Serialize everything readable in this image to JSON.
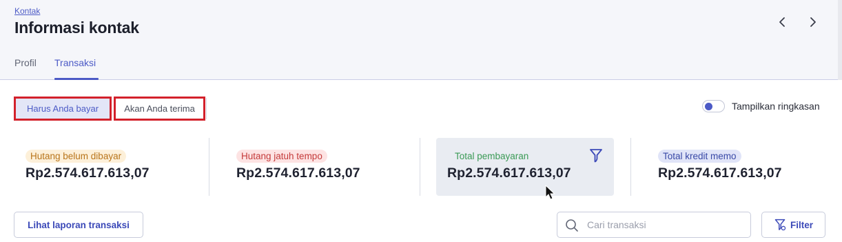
{
  "breadcrumb": "Kontak",
  "title": "Informasi kontak",
  "tabs": [
    {
      "label": "Profil",
      "active": false
    },
    {
      "label": "Transaksi",
      "active": true
    }
  ],
  "segments": [
    {
      "label": "Harus Anda bayar",
      "selected": true
    },
    {
      "label": "Akan Anda terima",
      "selected": false
    }
  ],
  "toggle": {
    "label": "Tampilkan ringkasan"
  },
  "summary": [
    {
      "label": "Hutang belum dibayar",
      "value": "Rp2.574.617.613,07",
      "color": "#b8741a"
    },
    {
      "label": "Hutang jatuh tempo",
      "value": "Rp2.574.617.613,07",
      "color": "#c43a3a"
    },
    {
      "label": "Total pembayaran",
      "value": "Rp2.574.617.613,07",
      "color": "#3a9a55"
    },
    {
      "label": "Total kredit memo",
      "value": "Rp2.574.617.613,07",
      "color": "#3848a6"
    }
  ],
  "actions": {
    "report_label": "Lihat laporan transaksi",
    "search_placeholder": "Cari transaksi",
    "filter_label": "Filter"
  },
  "colors": {
    "accent": "#4c5ac6",
    "highlight_border": "#d3212b"
  }
}
